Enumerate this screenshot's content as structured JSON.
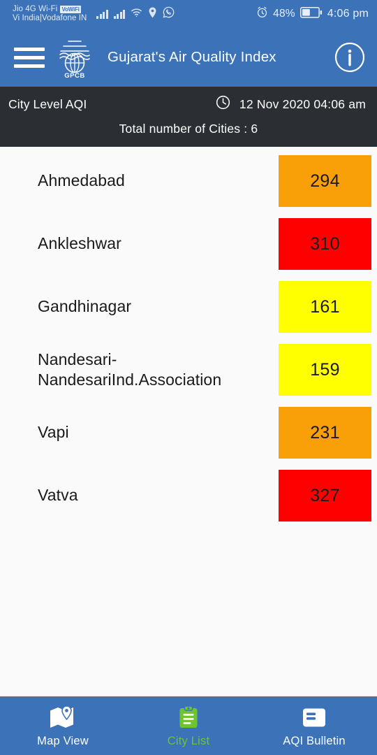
{
  "status_bar": {
    "carrier_line1": "Jio 4G Wi-Fi",
    "vowifi_badge": "VoWiFi",
    "carrier_line2": "Vi India|Vodafone IN",
    "battery_percent": "48%",
    "time": "4:06 pm"
  },
  "app_bar": {
    "title": "Gujarat's Air Quality Index",
    "logo_label": "GPCB"
  },
  "info_strip": {
    "title": "City Level AQI",
    "datetime": "12 Nov 2020 04:06 am",
    "total_cities": "Total number of Cities : 6"
  },
  "colors": {
    "brand_blue": "#3b72b8",
    "strip_dark": "#2b2f33",
    "active_green": "#6ec52f",
    "aqi_yellow": "#ffff00",
    "aqi_orange": "#f9a009",
    "aqi_red": "#ff0000"
  },
  "cities": [
    {
      "name": "Ahmedabad",
      "aqi": "294",
      "color": "#f9a009"
    },
    {
      "name": "Ankleshwar",
      "aqi": "310",
      "color": "#ff0000"
    },
    {
      "name": "Gandhinagar",
      "aqi": "161",
      "color": "#ffff00"
    },
    {
      "name": "Nandesari-NandesariInd.Association",
      "aqi": "159",
      "color": "#ffff00"
    },
    {
      "name": "Vapi",
      "aqi": "231",
      "color": "#f9a009"
    },
    {
      "name": "Vatva",
      "aqi": "327",
      "color": "#ff0000"
    }
  ],
  "bottom_nav": [
    {
      "label": "Map View",
      "icon": "map-view-icon",
      "active": false
    },
    {
      "label": "City List",
      "icon": "clipboard-icon",
      "active": true
    },
    {
      "label": "AQI Bulletin",
      "icon": "article-icon",
      "active": false
    }
  ]
}
